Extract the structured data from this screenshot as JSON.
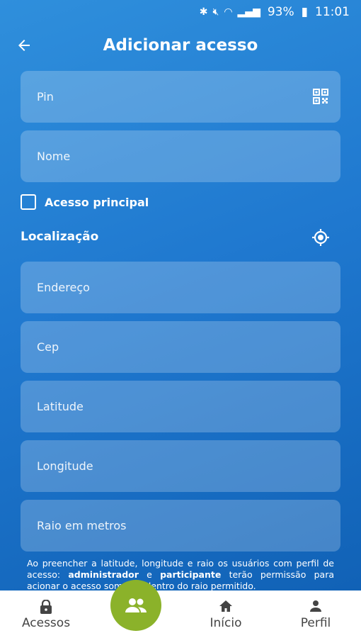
{
  "status": {
    "battery": "93%",
    "time": "11:01"
  },
  "header": {
    "title": "Adicionar acesso"
  },
  "form": {
    "pin_placeholder": "Pin",
    "name_placeholder": "Nome",
    "main_access_label": "Acesso principal",
    "location_title": "Localização",
    "address_placeholder": "Endereço",
    "cep_placeholder": "Cep",
    "latitude_placeholder": "Latitude",
    "longitude_placeholder": "Longitude",
    "radius_placeholder": "Raio em metros"
  },
  "note": {
    "part1": "Ao preencher a latitude, longitude e raio os usuários com perfil de acesso: ",
    "role1": "administrador",
    "part2": " e ",
    "role2": "participante",
    "part3": " terão permissão para acionar o acesso somente dentro do raio permitido."
  },
  "bottom_nav": {
    "items": [
      {
        "label": "Acessos"
      },
      {
        "label": "Início"
      },
      {
        "label": "Perfil"
      }
    ]
  },
  "colors": {
    "primary": "#1f78cf",
    "fab": "#8bb22a"
  }
}
